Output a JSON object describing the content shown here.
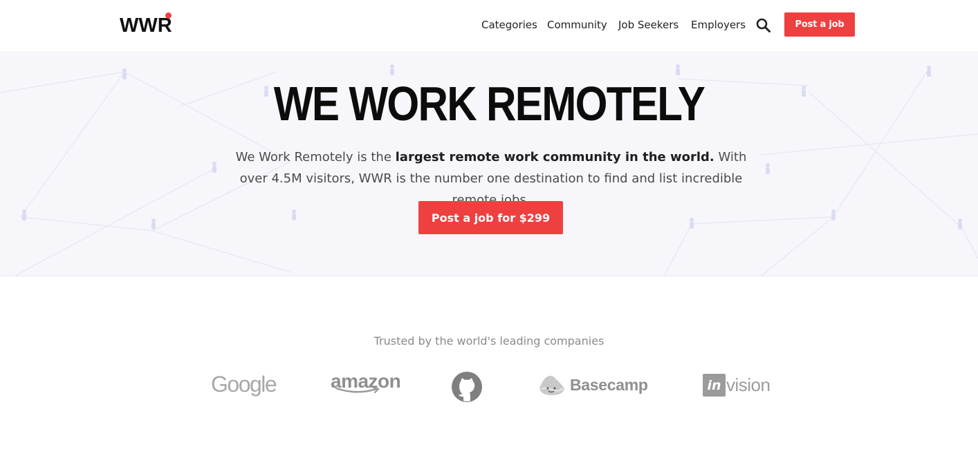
{
  "brand": {
    "logo_text": "WWR",
    "accent_color": "#ef4040"
  },
  "nav": {
    "items": [
      "Categories",
      "Community",
      "Job Seekers",
      "Employers"
    ],
    "search_icon": "search-icon",
    "post_job_label": "Post a job"
  },
  "hero": {
    "title": "WE WORK REMOTELY",
    "desc_prefix": "We Work Remotely is the ",
    "desc_bold": "largest remote work community in the world.",
    "desc_suffix": " With over 4.5M visitors, WWR is the number one destination to find and list incredible remote jobs.",
    "cta_label": "Post a job for $299"
  },
  "trusted": {
    "heading": "Trusted by the world's leading companies",
    "companies": [
      {
        "name": "Google",
        "icon": "google-logo"
      },
      {
        "name": "amazon",
        "icon": "amazon-logo"
      },
      {
        "name": "GitHub",
        "icon": "github-logo"
      },
      {
        "name": "Basecamp",
        "icon": "basecamp-logo"
      },
      {
        "name": "invision",
        "icon": "invision-logo"
      }
    ],
    "invision_box": "in",
    "invision_word": "vision"
  }
}
